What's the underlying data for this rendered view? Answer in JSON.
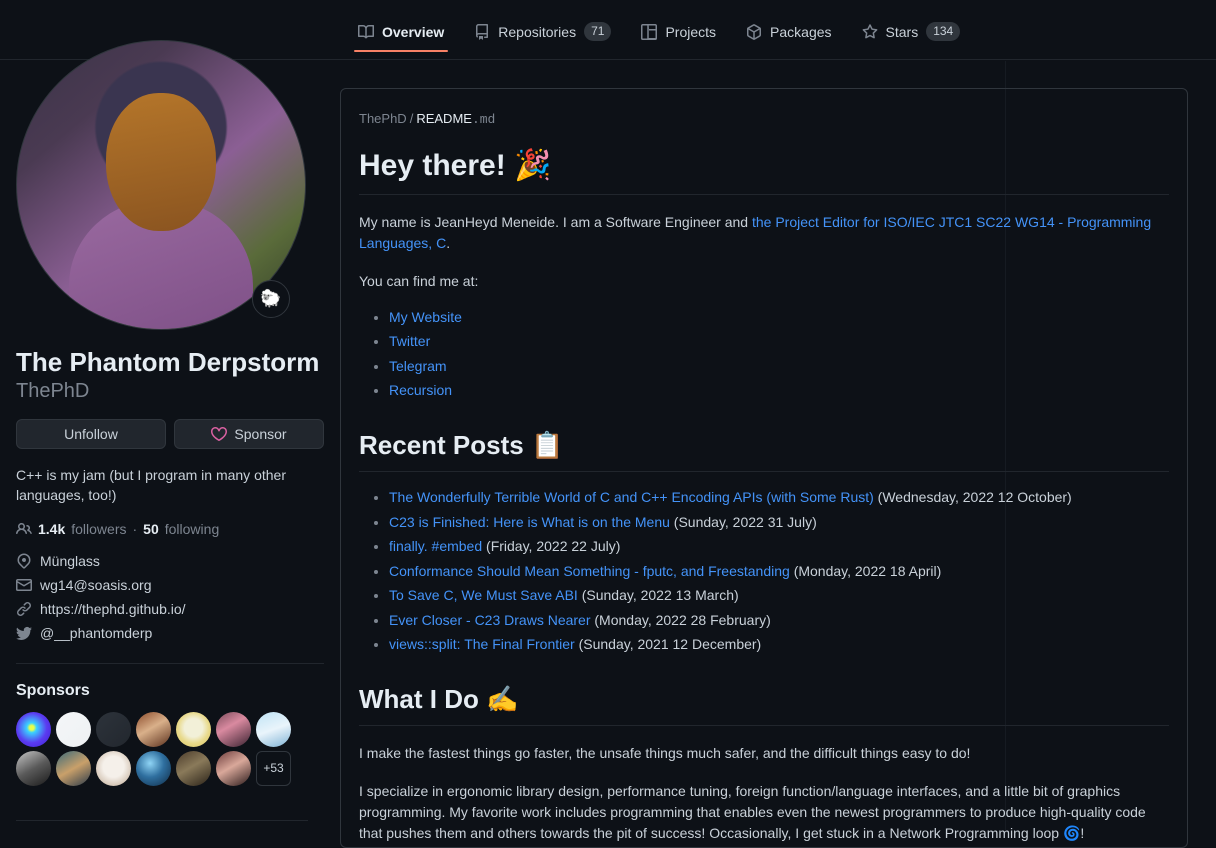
{
  "nav": {
    "items": [
      {
        "label": "Overview",
        "icon": "book-icon",
        "count": null,
        "active": true
      },
      {
        "label": "Repositories",
        "icon": "repo-icon",
        "count": "71",
        "active": false
      },
      {
        "label": "Projects",
        "icon": "project-icon",
        "count": null,
        "active": false
      },
      {
        "label": "Packages",
        "icon": "package-icon",
        "count": null,
        "active": false
      },
      {
        "label": "Stars",
        "icon": "star-icon",
        "count": "134",
        "active": false
      }
    ]
  },
  "profile": {
    "status_emoji": "🐑",
    "fullname": "The Phantom Derpstorm",
    "username": "ThePhD",
    "follow_button": "Unfollow",
    "sponsor_button": "Sponsor",
    "bio": "C++ is my jam (but I program in many other languages, too!)",
    "followers_count": "1.4k",
    "followers_label": "followers",
    "separator": "·",
    "following_count": "50",
    "following_label": "following",
    "meta": [
      {
        "icon": "location-icon",
        "text": "Münglass"
      },
      {
        "icon": "mail-icon",
        "text": "wg14@soasis.org"
      },
      {
        "icon": "link-icon",
        "text": "https://thephd.github.io/"
      },
      {
        "icon": "twitter-icon",
        "text": "@__phantomderp"
      }
    ],
    "sponsors_title": "Sponsors",
    "sponsors_more": "+53",
    "sponsor_avatars": [
      "radial-gradient(circle at 45% 45%, #e8ff4a 0 8%, #3ad1ff 18%, #5b3bf0 55%, #3a1fd0 100%)",
      "linear-gradient(135deg, #f4f6f8 0%, #eef1f3 100%)",
      "linear-gradient(135deg, #2d333b 0%, #22272e 100%)",
      "linear-gradient(150deg, #8a4a2a 0%, #d9b08a 45%, #5a2f1c 100%)",
      "radial-gradient(circle at 50% 45%, #f2f0d8 0 35%, #e8d98a 60%, #d9c45e 100%)",
      "linear-gradient(150deg, #7a4b5a 0%, #d98aa0 40%, #3a2230 100%)",
      "linear-gradient(160deg, #bfe3f5 0%, #e9f4fb 50%, #7fb3d5 100%)",
      "linear-gradient(150deg, #c9c9c9 0%, #5a5a5a 50%, #1a1a1a 100%)",
      "linear-gradient(150deg, #3a6a7a 0%, #c9a06a 50%, #2a3a4a 100%)",
      "radial-gradient(circle at 50% 45%, #f5f0ea 0 40%, #d8cabb 70%, #a89888 100%)",
      "radial-gradient(circle at 40% 35%, #8fd4f5 0%, #2f6f9f 45%, #0f2a44 100%)",
      "linear-gradient(150deg, #4a3a2a 0%, #8a7a5a 45%, #2a2218 100%)",
      "linear-gradient(150deg, #6a3a3a 0%, #d9a89a 45%, #2a1a1a 100%)"
    ]
  },
  "readme": {
    "breadcrumb_repo": "ThePhD",
    "breadcrumb_sep": "/",
    "breadcrumb_file": "README",
    "breadcrumb_ext": ".md",
    "heading1": "Hey there!",
    "heading1_emoji": "🎉",
    "intro_prefix": "My name is JeanHeyd Meneide. I am a Software Engineer and ",
    "intro_link": "the Project Editor for ISO/IEC JTC1 SC22 WG14 - Programming Languages, C",
    "intro_suffix": ".",
    "find_me": "You can find me at:",
    "links": [
      "My Website",
      "Twitter",
      "Telegram",
      "Recursion"
    ],
    "heading2": "Recent Posts",
    "heading2_emoji": "📋",
    "posts": [
      {
        "title": "The Wonderfully Terrible World of C and C++ Encoding APIs (with Some Rust)",
        "date": "(Wednesday, 2022 12 October)"
      },
      {
        "title": "C23 is Finished: Here is What is on the Menu",
        "date": "(Sunday, 2022 31 July)"
      },
      {
        "title": "finally. #embed",
        "date": "(Friday, 2022 22 July)"
      },
      {
        "title": "Conformance Should Mean Something - fputc, and Freestanding",
        "date": "(Monday, 2022 18 April)"
      },
      {
        "title": "To Save C, We Must Save ABI",
        "date": "(Sunday, 2022 13 March)"
      },
      {
        "title": "Ever Closer - C23 Draws Nearer",
        "date": "(Monday, 2022 28 February)"
      },
      {
        "title": "views::split: The Final Frontier",
        "date": "(Sunday, 2021 12 December)"
      }
    ],
    "heading3": "What I Do",
    "heading3_emoji": "✍️",
    "para1": "I make the fastest things go faster, the unsafe things much safer, and the difficult things easy to do!",
    "para2": "I specialize in ergonomic library design, performance tuning, foreign function/language interfaces, and a little bit of graphics programming. My favorite work includes programming that enables even the newest programmers to produce high-quality code that pushes them and others towards the pit of success! Occasionally, I get stuck in a Network Programming loop 🌀!"
  }
}
